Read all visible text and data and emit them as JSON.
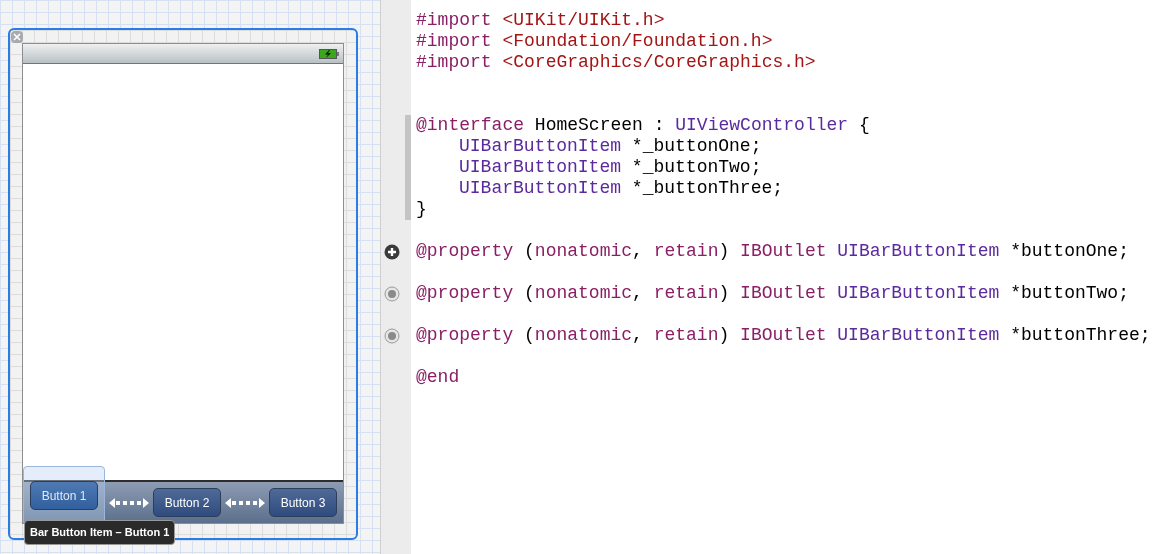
{
  "scene": {
    "toolbar": {
      "items": [
        {
          "kind": "button",
          "label": "Button 1",
          "selected": true
        },
        {
          "kind": "flexible_space"
        },
        {
          "kind": "button",
          "label": "Button 2",
          "selected": false
        },
        {
          "kind": "flexible_space"
        },
        {
          "kind": "button",
          "label": "Button 3",
          "selected": false
        }
      ]
    },
    "tooltip": "Bar Button Item – Button 1"
  },
  "code": {
    "lines": [
      {
        "kind": "import",
        "tokens": [
          {
            "kind": "keyword",
            "text": "#import "
          },
          {
            "kind": "string",
            "text": "<UIKit/UIKit.h>"
          }
        ]
      },
      {
        "kind": "import",
        "tokens": [
          {
            "kind": "keyword",
            "text": "#import "
          },
          {
            "kind": "string",
            "text": "<Foundation/Foundation.h>"
          }
        ]
      },
      {
        "kind": "import",
        "tokens": [
          {
            "kind": "keyword",
            "text": "#import "
          },
          {
            "kind": "string",
            "text": "<CoreGraphics/CoreGraphics.h>"
          }
        ]
      },
      {
        "kind": "interface",
        "highlight": true,
        "tokens": [
          {
            "kind": "keyword",
            "text": "@interface"
          },
          {
            "kind": "plain",
            "text": " HomeScreen : "
          },
          {
            "kind": "type",
            "text": "UIViewController"
          },
          {
            "kind": "plain",
            "text": " {"
          }
        ],
        "children": [
          {
            "kind": "member",
            "highlight": true,
            "tokens": [
              {
                "kind": "type",
                "text": "UIBarButtonItem"
              },
              {
                "kind": "plain",
                "text": " *_buttonOne;"
              }
            ]
          },
          {
            "kind": "member",
            "highlight": true,
            "tokens": [
              {
                "kind": "type",
                "text": "UIBarButtonItem"
              },
              {
                "kind": "plain",
                "text": " *_buttonTwo;"
              }
            ]
          },
          {
            "kind": "member",
            "highlight": true,
            "tokens": [
              {
                "kind": "type",
                "text": "UIBarButtonItem"
              },
              {
                "kind": "plain",
                "text": " *_buttonThree;"
              }
            ]
          }
        ]
      },
      {
        "kind": "close",
        "highlight": true,
        "tokens": [
          {
            "kind": "plain",
            "text": "}"
          }
        ]
      },
      {
        "kind": "property",
        "outlet": true,
        "hovered": true,
        "tokens": [
          {
            "kind": "keyword",
            "text": "@property"
          },
          {
            "kind": "plain",
            "text": " ("
          },
          {
            "kind": "keyword",
            "text": "nonatomic"
          },
          {
            "kind": "plain",
            "text": ", "
          },
          {
            "kind": "keyword",
            "text": "retain"
          },
          {
            "kind": "plain",
            "text": ") "
          },
          {
            "kind": "keyword",
            "text": "IBOutlet "
          },
          {
            "kind": "type",
            "text": "UIBarButtonItem"
          },
          {
            "kind": "plain",
            "text": " *buttonOne;"
          }
        ]
      },
      {
        "kind": "property",
        "outlet": true,
        "hovered": false,
        "tokens": [
          {
            "kind": "keyword",
            "text": "@property"
          },
          {
            "kind": "plain",
            "text": " ("
          },
          {
            "kind": "keyword",
            "text": "nonatomic"
          },
          {
            "kind": "plain",
            "text": ", "
          },
          {
            "kind": "keyword",
            "text": "retain"
          },
          {
            "kind": "plain",
            "text": ") "
          },
          {
            "kind": "keyword",
            "text": "IBOutlet "
          },
          {
            "kind": "type",
            "text": "UIBarButtonItem"
          },
          {
            "kind": "plain",
            "text": " *buttonTwo;"
          }
        ]
      },
      {
        "kind": "property",
        "outlet": true,
        "hovered": false,
        "tokens": [
          {
            "kind": "keyword",
            "text": "@property"
          },
          {
            "kind": "plain",
            "text": " ("
          },
          {
            "kind": "keyword",
            "text": "nonatomic"
          },
          {
            "kind": "plain",
            "text": ", "
          },
          {
            "kind": "keyword",
            "text": "retain"
          },
          {
            "kind": "plain",
            "text": ") "
          },
          {
            "kind": "keyword",
            "text": "IBOutlet "
          },
          {
            "kind": "type",
            "text": "UIBarButtonItem"
          },
          {
            "kind": "plain",
            "text": " *buttonThree;"
          }
        ]
      },
      {
        "kind": "end",
        "tokens": [
          {
            "kind": "keyword",
            "text": "@end"
          }
        ]
      }
    ]
  }
}
